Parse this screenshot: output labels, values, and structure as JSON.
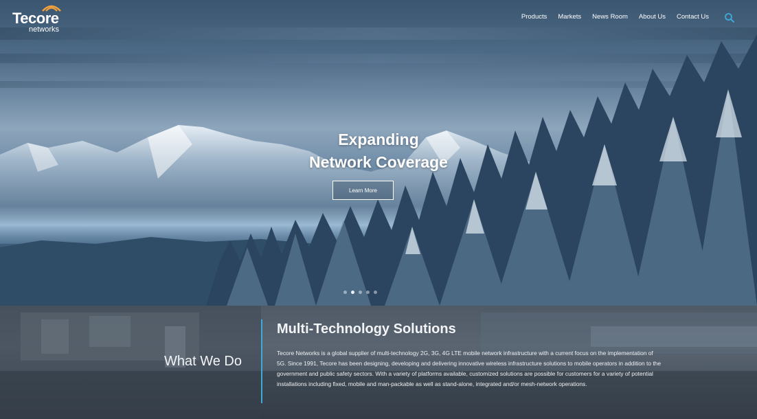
{
  "brand": {
    "name": "Tecore",
    "sub": "networks",
    "accent": "#f3a13a"
  },
  "nav": {
    "items": [
      "Products",
      "Markets",
      "News Room",
      "About Us",
      "Contact Us"
    ],
    "search_icon": "search-icon",
    "search_color": "#3fa9d8"
  },
  "hero": {
    "title_line1": "Expanding",
    "title_line2": "Network Coverage",
    "button_label": "Learn More",
    "slides": 5,
    "active_slide": 1
  },
  "what_we_do": {
    "heading": "What We Do",
    "title": "Multi-Technology Solutions",
    "body": "Tecore Networks is a global supplier of multi-technology 2G, 3G, 4G LTE mobile network infrastructure with a current focus on the implementation of 5G. Since 1991, Tecore has been designing, developing and delivering innovative wireless infrastructure solutions to mobile operators in addition to the government and public safety sectors. With a variety of platforms available, customized solutions are possible for customers for a variety of potential installations including fixed, mobile and man-packable as well as stand-alone, integrated and/or mesh-network operations.",
    "divider_color": "#3fa9d8"
  }
}
